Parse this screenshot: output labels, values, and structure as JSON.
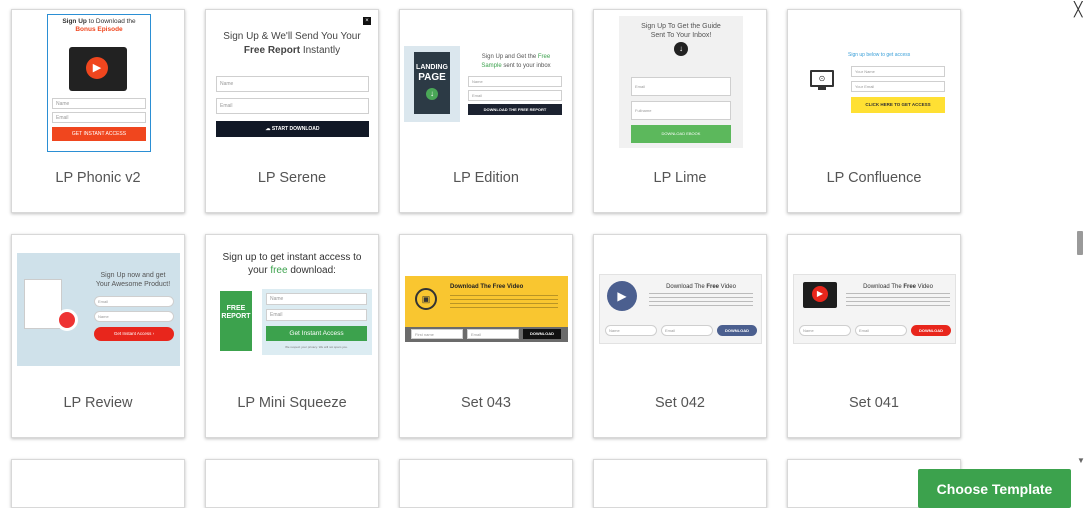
{
  "templates": [
    {
      "name": "LP Phonic v2"
    },
    {
      "name": "LP Serene"
    },
    {
      "name": "LP Edition"
    },
    {
      "name": "LP Lime"
    },
    {
      "name": "LP Confluence"
    },
    {
      "name": "LP Review"
    },
    {
      "name": "LP Mini Squeeze"
    },
    {
      "name": "Set 043"
    },
    {
      "name": "Set 042"
    },
    {
      "name": "Set 041"
    }
  ],
  "thumbs": {
    "phonic": {
      "h1": "Sign Up",
      "h2": " to Download the",
      "h3": "Bonus Episode",
      "f1": "Name",
      "f2": "Email",
      "btn": "GET INSTANT ACCESS"
    },
    "serene": {
      "h1": "Sign Up & We'll Send You Your",
      "h2b": "Free Report",
      "h2": " Instantly",
      "f1": "Name",
      "f2": "Email",
      "btn": "START DOWNLOAD"
    },
    "edition": {
      "book1": "LANDING",
      "book2": "PAGE",
      "h1": "Sign Up and Get the ",
      "h1g": "Free",
      "h2g": "Sample",
      "h2": " sent to your inbox",
      "f1": "Name",
      "f2": "Email",
      "btn": "DOWNLOAD THE FREE REPORT"
    },
    "lime": {
      "h1": "Sign Up To Get the Guide",
      "h2": "Sent To Your Inbox!",
      "f1": "Email",
      "f2": "Fullname",
      "btn": "DOWNLOAD EBOOK"
    },
    "confluence": {
      "h1": "Sign up below to get access",
      "f1": "Your Name",
      "f2": "Your Email",
      "btn": "CLICK HERE TO GET ACCESS"
    },
    "review": {
      "h1": "Sign Up now and get",
      "h2": "Your Awesome Product!",
      "f1": "Email",
      "f2": "Name",
      "btn": "Get Instant Access  ›"
    },
    "mini": {
      "h1": "Sign up to get instant access to",
      "h2a": "your ",
      "h2g": "free",
      "h2b": " download:",
      "book": "FREE REPORT",
      "f1": "Name",
      "f2": "Email",
      "btn": "Get Instant Access",
      "note": "We respect your privacy. We will not spam you."
    },
    "s043": {
      "h1": "Download The Free Video",
      "f1": "First name",
      "f2": "Email",
      "btn": "DOWNLOAD"
    },
    "s042": {
      "h1a": "Download The ",
      "h1b": "Free",
      "h1c": " Video",
      "f1": "Name",
      "f2": "Email",
      "btn": "DOWNLOAD"
    },
    "s041": {
      "h1a": "Download The ",
      "h1b": "Free",
      "h1c": " Video",
      "f1": "Name",
      "f2": "Email",
      "btn": "DOWNLOAD"
    }
  },
  "choose_button": "Choose Template",
  "colors": {
    "green": "#3ca24d",
    "red": "#f0461e",
    "yellow": "#ffe033",
    "navy": "#1c2230",
    "lime": "#5cb85c"
  }
}
